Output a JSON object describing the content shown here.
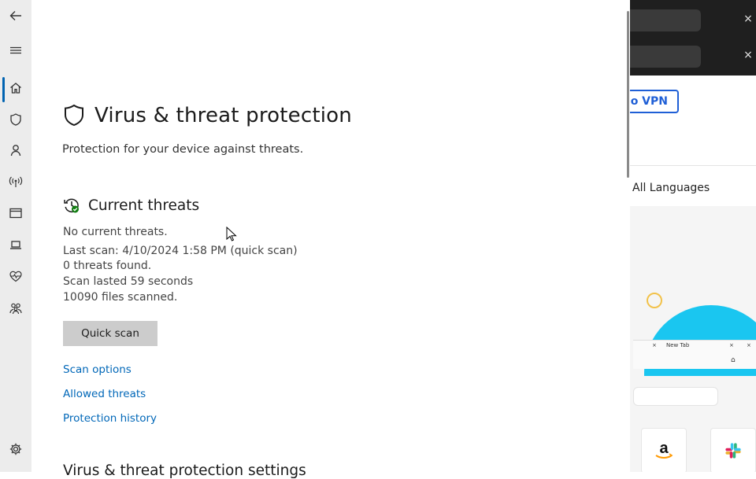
{
  "nav": {
    "items": [
      {
        "icon": "back-arrow-icon"
      },
      {
        "icon": "hamburger-icon"
      },
      {
        "icon": "home-icon"
      },
      {
        "icon": "shield-icon"
      },
      {
        "icon": "person-icon"
      },
      {
        "icon": "wireless-icon"
      },
      {
        "icon": "app-browser-icon"
      },
      {
        "icon": "laptop-icon"
      },
      {
        "icon": "heart-pulse-icon"
      },
      {
        "icon": "family-icon"
      },
      {
        "icon": "gear-icon"
      }
    ],
    "selected_index": 2
  },
  "page": {
    "title": "Virus & threat protection",
    "subtitle": "Protection for your device against threats."
  },
  "current_threats": {
    "heading": "Current threats",
    "status": "No current threats.",
    "last_scan": "Last scan: 4/10/2024 1:58 PM (quick scan)",
    "threats_found": "0 threats found.",
    "scan_duration": "Scan lasted 59 seconds",
    "files_scanned": "10090 files scanned.",
    "quick_scan_label": "Quick scan",
    "links": {
      "scan_options": "Scan options",
      "allowed_threats": "Allowed threats",
      "protection_history": "Protection history"
    }
  },
  "next_section": {
    "heading": "Virus & threat protection settings"
  },
  "browser": {
    "tab_close": "×",
    "vpn_label": "o VPN",
    "languages_label": "All Languages",
    "mini_tab_label": "New Tab",
    "colors": {
      "vpn_blue": "#1f5fd6",
      "wave_cyan": "#1ac6f0",
      "tab_dark": "#1f1f1f"
    }
  },
  "colors": {
    "link": "#0067b8",
    "accent": "#0063b1",
    "button_bg": "#cccccc",
    "rail_bg": "#ececec",
    "ok_green": "#107c10"
  }
}
